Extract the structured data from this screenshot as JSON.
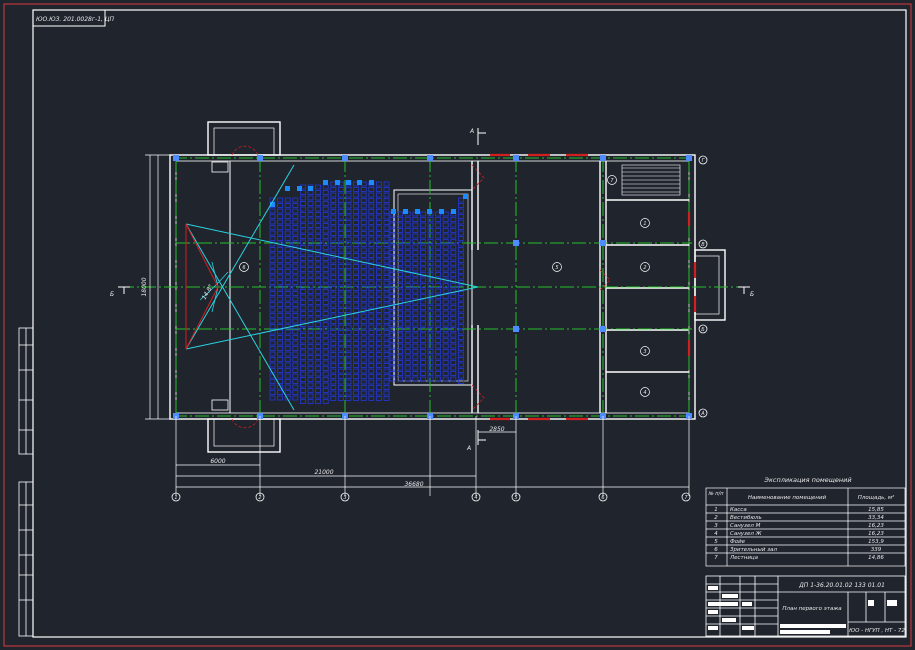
{
  "stamp": "ЮО.ЮЗ. 201.0028г-1, ЦП",
  "dimensions": {
    "total_height": "18000",
    "to_axis_2": "6000",
    "to_axis_4": "21000",
    "to_axis_7": "36680",
    "door_offset": "2850"
  },
  "axes": {
    "vertical": [
      "1",
      "2",
      "3",
      "4",
      "5",
      "6",
      "7"
    ],
    "horizontal": [
      "Г",
      "В",
      "Б",
      "А"
    ]
  },
  "section_marks": {
    "a": "А",
    "b": "Б"
  },
  "sightline_label": "14.8°",
  "room_tags": [
    {
      "id": "6",
      "label": "6"
    },
    {
      "id": "5",
      "label": "5"
    },
    {
      "id": "7",
      "label": "7"
    },
    {
      "id": "1",
      "label": "1"
    },
    {
      "id": "2",
      "label": "2"
    },
    {
      "id": "3",
      "label": "3"
    },
    {
      "id": "4",
      "label": "4"
    }
  ],
  "explication": {
    "title": "Экспликация помещений",
    "headers": [
      "№ п/п",
      "Наименование помещений",
      "Площадь, м²"
    ],
    "rows": [
      [
        "1",
        "Касса",
        "15,85"
      ],
      [
        "2",
        "Вестибюль",
        "33,34"
      ],
      [
        "3",
        "Санузел М",
        "16,23"
      ],
      [
        "4",
        "Санузел Ж",
        "16,23"
      ],
      [
        "5",
        "Фойе",
        "153,9"
      ],
      [
        "6",
        "Зрительный зал",
        "339"
      ],
      [
        "7",
        "Лестница",
        "14,86"
      ]
    ]
  },
  "title_block": {
    "code": "ДП 1-36.20.01.02 133 01.01",
    "sheet_title": "План первого этажа",
    "org": "ЮО - НГУП , НТ - 72"
  },
  "colors": {
    "background": "#1f242d",
    "frame": "#ffffff",
    "outer_frame": "#d83a3a",
    "axis_lines": "#27c12a",
    "seats": "#2438d8",
    "sightlines": "#2ad2e0",
    "stairs_red": "#d02020"
  }
}
